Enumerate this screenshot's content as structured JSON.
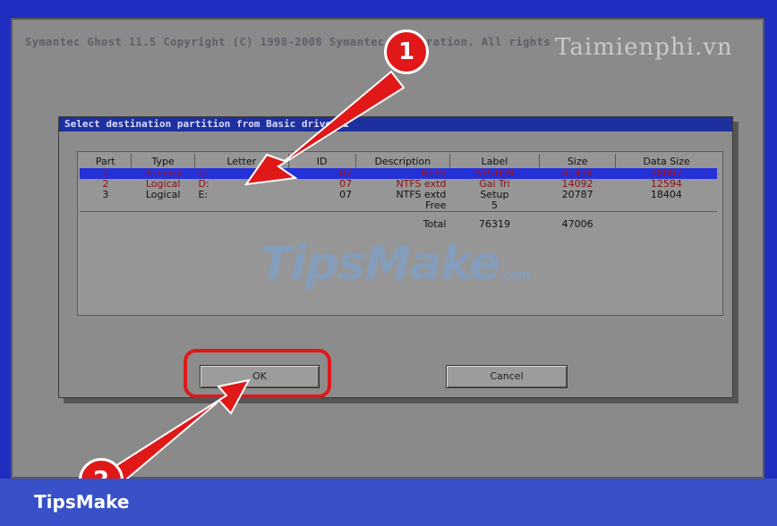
{
  "app": {
    "title": "Symantec Ghost 11.5   Copyright (C) 1998-2008 Symantec Corporation. All rights",
    "watermark": "Taimienphi.vn"
  },
  "dialog": {
    "title": "Select destination partition from Basic drive: 1",
    "columns": [
      "Part",
      "Type",
      "Letter",
      "ID",
      "Description",
      "Label",
      "Size",
      "Data Size"
    ],
    "rows": [
      {
        "part": "1",
        "type": "Primary",
        "letter": "C:",
        "id": "07",
        "desc": "NTFS",
        "label": "SYSTEM",
        "size": "41434",
        "data": "38087"
      },
      {
        "part": "2",
        "type": "Logical",
        "letter": "D:",
        "id": "07",
        "desc": "NTFS extd",
        "label": "Gai Tri",
        "size": "14092",
        "data": "12594"
      },
      {
        "part": "3",
        "type": "Logical",
        "letter": "E:",
        "id": "07",
        "desc": "NTFS extd",
        "label": "Setup",
        "size": "20787",
        "data": "18404"
      }
    ],
    "free": {
      "desc": "Free",
      "label": "5"
    },
    "total": {
      "desc": "Total",
      "label": "76319",
      "size": "47006"
    },
    "ok_label": "OK",
    "cancel_label": "Cancel"
  },
  "annotations": {
    "step1": "1",
    "step2": "2",
    "highlight_color": "#e01818"
  },
  "watermark_center": {
    "main": "TipsMake",
    "suffix": ".com"
  },
  "footer": {
    "brand": "TipsMake"
  }
}
